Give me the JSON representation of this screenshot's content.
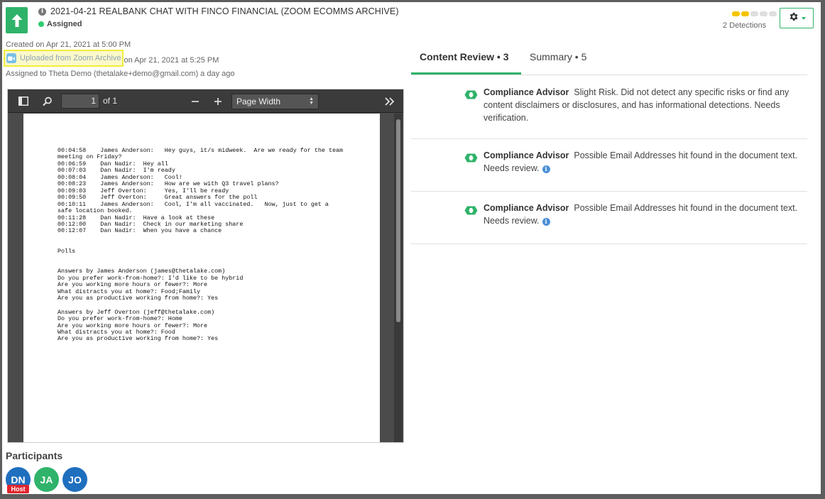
{
  "header": {
    "title": "2021-04-21 REALBANK CHAT WITH FINCO FINANCIAL (ZOOM ECOMMS ARCHIVE)",
    "status": "Assigned",
    "detections_label": "2 Detections",
    "detection_level": 2,
    "detection_level_max": 5
  },
  "meta": {
    "created": "Created on Apr 21, 2021 at 5:00 PM",
    "uploaded_link": "Uploaded from Zoom Archive",
    "uploaded_date": " on Apr 21, 2021 at 5:25 PM",
    "assigned": "Assigned to Theta Demo (thetalake+demo@gmail.com) a day ago"
  },
  "viewer": {
    "page_number": "1",
    "page_of": "of 1",
    "zoom_value": "Page Width",
    "transcript_lines": [
      "00:04:58    James Anderson:   Hey guys, it/s midweek.  Are we ready for the team",
      "meeting on Friday?",
      "00:06:59    Dan Nadir:  Hey all",
      "00:07:03    Dan Nadir:  I'm ready",
      "00:08:04    James Anderson:   Cool!",
      "00:08:23    James Anderson:   How are we with Q3 travel plans?",
      "00:09:03    Jeff Overton:     Yes, I'll be ready",
      "00:09:50    Jeff Overton:     Great answers for the poll",
      "00:10:11    James Anderson:   Cool, I'm all vaccinated.   Now, just to get a",
      "safe location booked.",
      "00:11:28    Dan Nadir:  Have a look at these",
      "00:12:00    Dan Nadir:  Check in our marketing share",
      "00:12:07    Dan Nadir:  When you have a chance"
    ],
    "polls_title": "Polls",
    "poll_blocks": [
      [
        "Answers by James Anderson (james@thetalake.com)",
        "Do you prefer work-from-home?: I'd like to be hybrid",
        "Are you working more hours or fewer?: More",
        "What distracts you at home?: Food;Family",
        "Are you as productive working from home?: Yes"
      ],
      [
        "Answers by Jeff Overton (jeff@thetalake.com)",
        "Do you prefer work-from-home?: Home",
        "Are you working more hours or fewer?: More",
        "What distracts you at home?: Food",
        "Are you as productive working from home?: Yes"
      ]
    ]
  },
  "participants": {
    "title": "Participants",
    "people": [
      {
        "initials": "DN",
        "color": "#1f6fbf",
        "host": true
      },
      {
        "initials": "JA",
        "color": "#2fb36a",
        "host": false
      },
      {
        "initials": "JO",
        "color": "#1f6fbf",
        "host": false
      }
    ],
    "host_label": "Host"
  },
  "tabs": {
    "content_review": "Content Review • 3",
    "summary": "Summary • 5"
  },
  "detections": [
    {
      "source": "Compliance Advisor",
      "text": "Slight Risk. Did not detect any specific risks or find any content disclaimers or disclosures, and has informational detections. Needs verification.",
      "info": false
    },
    {
      "source": "Compliance Advisor",
      "text": "Possible Email Addresses hit found in the document text. Needs review.",
      "info": true
    },
    {
      "source": "Compliance Advisor",
      "text": "Possible Email Addresses hit found in the document text. Needs review.",
      "info": true
    }
  ],
  "colors": {
    "brand_green": "#2fb36a",
    "status_green": "#2fcc71",
    "detection_yellow": "#f5c400",
    "highlight_yellow": "#f1ec3e"
  }
}
